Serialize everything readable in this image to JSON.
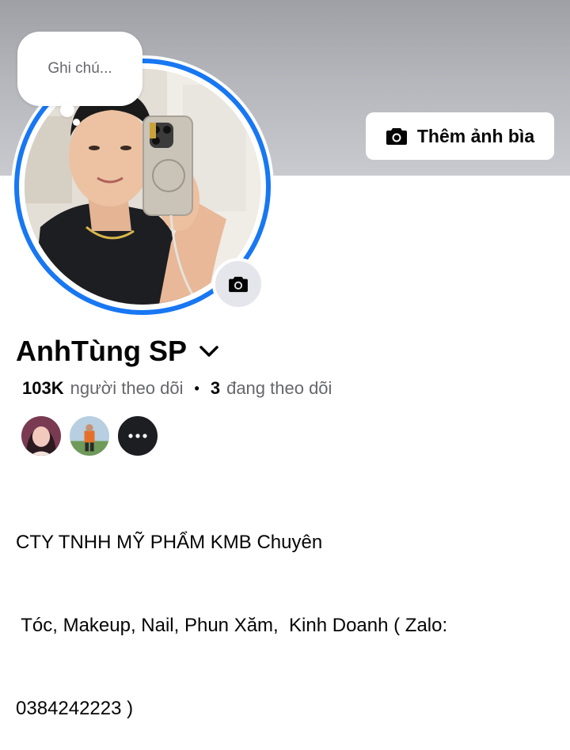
{
  "cover": {
    "add_cover_label": "Thêm ảnh bìa",
    "add_cover_icon": "camera-icon",
    "background_color": "#b4b6bb"
  },
  "note": {
    "placeholder_text": "Ghi chú..."
  },
  "avatar": {
    "ring_color": "#1877f2",
    "camera_icon": "camera-icon"
  },
  "profile": {
    "name": "AnhTùng SP",
    "name_dropdown_icon": "chevron-down-icon"
  },
  "stats": {
    "followers_count": "103K",
    "followers_label": "người theo dõi",
    "separator": "•",
    "following_count": "3",
    "following_label": "đang theo dõi"
  },
  "followers_preview": {
    "avatars": [
      "follower-avatar-1",
      "follower-avatar-2"
    ],
    "more_icon": "more-dots-icon"
  },
  "bio": {
    "lines": [
      "CTY TNHH MỸ PHẨM KMB Chuyên",
      " Tóc, Makeup, Nail, Phun Xăm,  Kinh Doanh ( Zalo:",
      "0384242223 )"
    ]
  },
  "colors": {
    "accent": "#1877f2",
    "text_primary": "#050505",
    "text_secondary": "#65676b"
  }
}
